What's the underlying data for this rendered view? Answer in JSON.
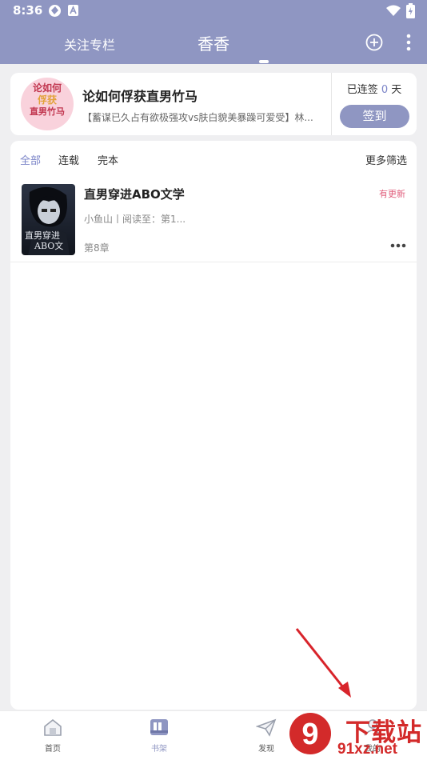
{
  "status_bar": {
    "time": "8:36"
  },
  "header": {
    "tab_left": "关注专栏",
    "tab_center": "香香"
  },
  "signin": {
    "cover_text": [
      "论如何",
      "俘获",
      "直男竹马"
    ],
    "title": "论如何俘获直男竹马",
    "description": "【蓄谋已久占有欲极强攻vs肤白貌美暴躁可爱受】林...",
    "streak_prefix": "已连签",
    "streak_count": "0",
    "streak_suffix": "天",
    "button_label": "签到"
  },
  "shelf": {
    "filters": [
      "全部",
      "连载",
      "完本"
    ],
    "more_filter": "更多筛选",
    "books": [
      {
        "cover_text": [
          "直男穿进",
          "ABO文"
        ],
        "title": "直男穿进ABO文学",
        "badge": "有更新",
        "meta": "小鱼山丨阅读至：第1...",
        "chapter": "第8章"
      }
    ]
  },
  "bottom_nav": [
    {
      "label": "首页",
      "icon": "home-icon"
    },
    {
      "label": "书架",
      "icon": "bookshelf-icon"
    },
    {
      "label": "发现",
      "icon": "paper-plane-icon"
    },
    {
      "label": "我的",
      "icon": "profile-icon"
    }
  ],
  "watermark": {
    "main": "下载站",
    "sub": "91xz.net",
    "logo": "9"
  },
  "colors": {
    "accent": "#8f96c2",
    "active_text": "#7b84c8",
    "update_badge": "#e0607e"
  }
}
